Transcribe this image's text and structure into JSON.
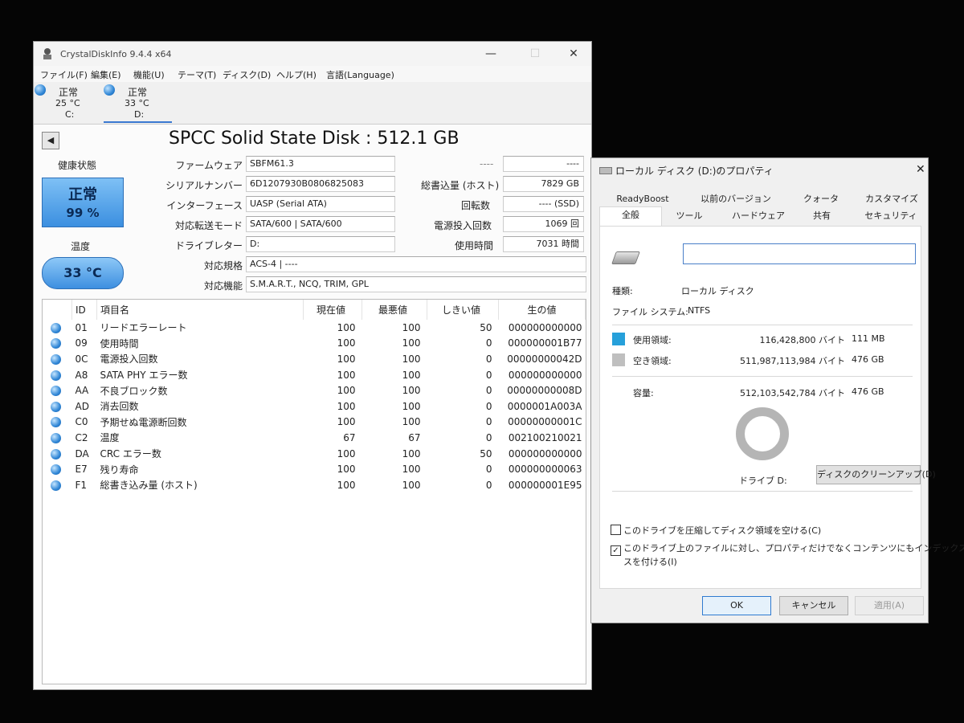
{
  "cdi": {
    "title": "CrystalDiskInfo 9.4.4 x64",
    "menu": [
      "ファイル(F)",
      "編集(E)",
      "機能(U)",
      "テーマ(T)",
      "ディスク(D)",
      "ヘルプ(H)",
      "言語(Language)"
    ],
    "disks": [
      {
        "status": "正常",
        "temp": "25 °C",
        "letter": "C:"
      },
      {
        "status": "正常",
        "temp": "33 °C",
        "letter": "D:"
      }
    ],
    "disk_title": "SPCC Solid State Disk : 512.1 GB",
    "health_label": "健康状態",
    "health_status": "正常",
    "health_percent": "99 %",
    "temp_label": "温度",
    "temp_value": "33 °C",
    "info": {
      "firmware_label": "ファームウェア",
      "firmware": "SBFM61.3",
      "serial_label": "シリアルナンバー",
      "serial": "6D1207930B0806825083",
      "interface_label": "インターフェース",
      "interface": "UASP (Serial ATA)",
      "transfer_label": "対応転送モード",
      "transfer": "SATA/600 | SATA/600",
      "letter_label": "ドライブレター",
      "letter": "D:",
      "standard_label": "対応規格",
      "standard": "ACS-4 | ----",
      "features_label": "対応機能",
      "features": "S.M.A.R.T., NCQ, TRIM, GPL",
      "blank_left": "----",
      "blank_right": "----",
      "host_writes_label": "総書込量 (ホスト)",
      "host_writes": "7829 GB",
      "rotation_label": "回転数",
      "rotation": "---- (SSD)",
      "power_count_label": "電源投入回数",
      "power_count": "1069 回",
      "power_hours_label": "使用時間",
      "power_hours": "7031 時間"
    },
    "smart_headers": [
      "ID",
      "項目名",
      "現在値",
      "最悪値",
      "しきい値",
      "生の値"
    ],
    "smart_rows": [
      [
        "01",
        "リードエラーレート",
        "100",
        "100",
        "50",
        "000000000000"
      ],
      [
        "09",
        "使用時間",
        "100",
        "100",
        "0",
        "000000001B77"
      ],
      [
        "0C",
        "電源投入回数",
        "100",
        "100",
        "0",
        "00000000042D"
      ],
      [
        "A8",
        "SATA PHY エラー数",
        "100",
        "100",
        "0",
        "000000000000"
      ],
      [
        "AA",
        "不良ブロック数",
        "100",
        "100",
        "0",
        "00000000008D"
      ],
      [
        "AD",
        "消去回数",
        "100",
        "100",
        "0",
        "0000001A003A"
      ],
      [
        "C0",
        "予期せぬ電源断回数",
        "100",
        "100",
        "0",
        "00000000001C"
      ],
      [
        "C2",
        "温度",
        "67",
        "67",
        "0",
        "002100210021"
      ],
      [
        "DA",
        "CRC エラー数",
        "100",
        "100",
        "50",
        "000000000000"
      ],
      [
        "E7",
        "残り寿命",
        "100",
        "100",
        "0",
        "000000000063"
      ],
      [
        "F1",
        "総書き込み量 (ホスト)",
        "100",
        "100",
        "0",
        "000000001E95"
      ]
    ]
  },
  "props": {
    "title": "ローカル ディスク (D:)のプロパティ",
    "tabs_top": [
      "ReadyBoost",
      "以前のバージョン",
      "クォータ",
      "カスタマイズ"
    ],
    "tabs_bottom": [
      "全般",
      "ツール",
      "ハードウェア",
      "共有",
      "セキュリティ"
    ],
    "type_label": "種類:",
    "type_value": "ローカル ディスク",
    "fs_label": "ファイル システム:",
    "fs_value": "NTFS",
    "used_label": "使用領域:",
    "used_bytes": "116,428,800 バイト",
    "used_size": "111 MB",
    "free_label": "空き領域:",
    "free_bytes": "511,987,113,984 バイト",
    "free_size": "476 GB",
    "cap_label": "容量:",
    "cap_bytes": "512,103,542,784 バイト",
    "cap_size": "476 GB",
    "drive_label": "ドライブ D:",
    "cleanup_button": "ディスクのクリーンアップ(D)",
    "compress_label": "このドライブを圧縮してディスク領域を空ける(C)",
    "index_label_1": "このドライブ上のファイルに対し、プロパティだけでなくコンテンツにもインデックス",
    "index_label_2": "スを付ける(I)",
    "compress_checked": false,
    "index_checked": true,
    "ok": "OK",
    "cancel": "キャンセル",
    "apply": "適用(A)",
    "used_color": "#26a0da",
    "free_color": "#bfbfbf"
  }
}
